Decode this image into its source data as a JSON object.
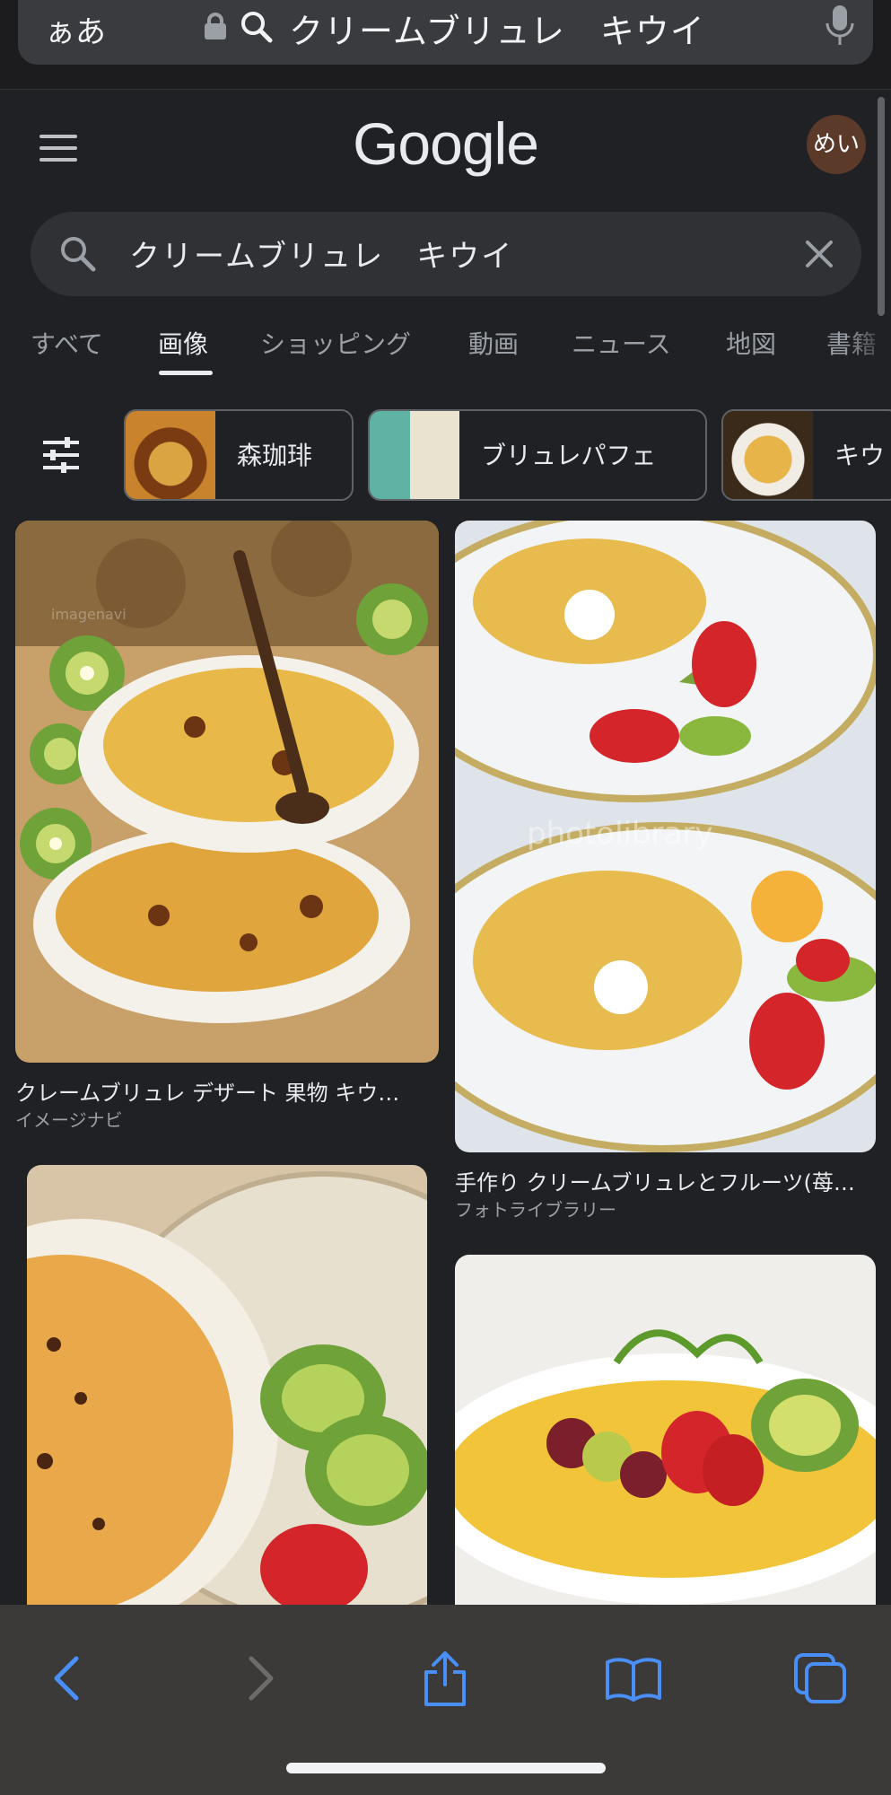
{
  "browser": {
    "aa_label": "ぁあ",
    "url_text": "クリームブリュレ　キウイ"
  },
  "google": {
    "logo": "Google",
    "avatar_text": "めい"
  },
  "search": {
    "query": "クリームブリュレ　キウイ"
  },
  "tabs": [
    {
      "label": "すべて",
      "active": false
    },
    {
      "label": "画像",
      "active": true
    },
    {
      "label": "ショッピング",
      "active": false
    },
    {
      "label": "動画",
      "active": false
    },
    {
      "label": "ニュース",
      "active": false
    },
    {
      "label": "地図",
      "active": false
    },
    {
      "label": "書籍",
      "active": false
    }
  ],
  "chips": [
    {
      "label": "森珈琲"
    },
    {
      "label": "ブリュレパフェ"
    },
    {
      "label": "キウ"
    }
  ],
  "results": [
    {
      "caption": "クレームブリュレ デザート 果物 キウ…",
      "source": "イメージナビ"
    },
    {
      "caption": "手作り クリームブリュレとフルーツ(苺…",
      "source": "フォトライブラリー"
    },
    {
      "caption": "",
      "source": ""
    },
    {
      "caption": "",
      "source": ""
    }
  ],
  "toolbar": {
    "icons": [
      "back-icon",
      "forward-icon",
      "share-icon",
      "bookmarks-icon",
      "tabs-icon"
    ]
  }
}
